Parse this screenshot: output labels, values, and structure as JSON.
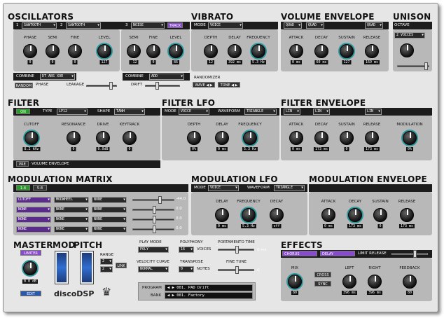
{
  "osc": {
    "title": "OSCILLATORS",
    "n1": "1",
    "w1": "SAWTOOTH",
    "n2": "2",
    "w2": "SAWTOOTH",
    "n3": "3",
    "w3": "NOISE",
    "track": "TRACK",
    "k": [
      {
        "l": "PHASE",
        "v": "0"
      },
      {
        "l": "SEMI",
        "v": "0"
      },
      {
        "l": "FINE",
        "v": "0"
      },
      {
        "l": "LEVEL",
        "v": "127"
      },
      {
        "l": "SEMI",
        "v": "-12"
      },
      {
        "l": "FINE",
        "v": "0"
      },
      {
        "l": "LEVEL",
        "v": "86"
      }
    ],
    "combine": "COMBINE",
    "comb1": "DT ABS XOR",
    "comb2": "ADD",
    "random": "RANDOM",
    "phase": "PHASE",
    "leakage": "LEAKAGE",
    "drift": "DRIFT"
  },
  "vib": {
    "title": "VIBRATO",
    "mode": "MODE",
    "modev": "VOICE",
    "k": [
      {
        "l": "DEPTH",
        "v": "12"
      },
      {
        "l": "DELAY",
        "v": "392 ms"
      },
      {
        "l": "FREQUENCY",
        "v": "5.3 Hz"
      }
    ],
    "randomizer": "RANDOMIZER",
    "wave": "WAVE",
    "tone": "TONE"
  },
  "venv": {
    "title": "VOLUME ENVELOPE",
    "q1": "QUAD",
    "q2": "QUAD",
    "q3": "QUAD",
    "k": [
      {
        "l": "ATTACK",
        "v": "0 ms"
      },
      {
        "l": "DECAY",
        "v": "60 ms"
      },
      {
        "l": "SUSTAIN",
        "v": "127"
      },
      {
        "l": "RELEASE",
        "v": "169 ms"
      }
    ]
  },
  "uni": {
    "title": "UNISON",
    "octave": "OCTAVE",
    "voices": "2 VOICES"
  },
  "flt": {
    "title": "FILTER",
    "on": "ON",
    "type": "TYPE",
    "typev": "LP12",
    "shape": "SHAPE",
    "shapev": "TANH",
    "k": [
      {
        "l": "CUTOFF",
        "v": "8.2 kHz"
      },
      {
        "l": "RESONANCE",
        "v": "0"
      },
      {
        "l": "DRIVE",
        "v": "0.0dB"
      },
      {
        "l": "KEYTRACK",
        "v": "0"
      }
    ],
    "pre": "PRE",
    "venv": "VOLUME ENVELOPE"
  },
  "flfo": {
    "title": "FILTER LFO",
    "mode": "MODE",
    "modev": "VOICE",
    "wf": "WAVEFORM",
    "wfv": "TRIANGLE",
    "k": [
      {
        "l": "DEPTH",
        "v": "0%"
      },
      {
        "l": "DELAY",
        "v": "0 ms"
      },
      {
        "l": "FREQUENCY",
        "v": "5.3 Hz"
      }
    ]
  },
  "fenv": {
    "title": "FILTER ENVELOPE",
    "l1": "LIN",
    "l2": "LIN",
    "l3": "LIN",
    "k": [
      {
        "l": "ATTACK",
        "v": "0 ms"
      },
      {
        "l": "DECAY",
        "v": "173 ms"
      },
      {
        "l": "SUSTAIN",
        "v": "0"
      },
      {
        "l": "RELEASE",
        "v": "173 ms"
      },
      {
        "l": "MODULATION",
        "v": "0%"
      }
    ]
  },
  "mm": {
    "title": "MODULATION MATRIX",
    "t1": "1-4",
    "t2": "5-8",
    "rows": [
      {
        "s": "CUTOFF",
        "a": "MODWHEEL",
        "b": "NONE",
        "v": "-44.0"
      },
      {
        "s": "NONE",
        "a": "NONE",
        "b": "NONE",
        "v": "0.0"
      },
      {
        "s": "NONE",
        "a": "NONE",
        "b": "NONE",
        "v": "0.0"
      },
      {
        "s": "NONE",
        "a": "NONE",
        "b": "NONE",
        "v": "0.0"
      }
    ]
  },
  "mlfo": {
    "title": "MODULATION LFO",
    "mode": "MODE",
    "modev": "VOICE",
    "wf": "WAVEFORM",
    "wfv": "TRIANGLE",
    "k": [
      {
        "l": "DELAY",
        "v": "0 ms"
      },
      {
        "l": "FREQUENCY",
        "v": "5.3 Hz"
      },
      {
        "l": "DECAY",
        "v": "off"
      }
    ]
  },
  "menv": {
    "title": "MODULATION ENVELOPE",
    "k": [
      {
        "l": "ATTACK",
        "v": "0 ms"
      },
      {
        "l": "DECAY",
        "v": "173 ms"
      },
      {
        "l": "SUSTAIN",
        "v": "0"
      },
      {
        "l": "RELEASE",
        "v": "173 ms"
      }
    ]
  },
  "mst": {
    "master": "MASTER",
    "mod": "MOD",
    "pitch": "PITCH",
    "limiter": "LIMITER",
    "vol": "0.0 dB",
    "edit": "EDIT",
    "range": "RANGE",
    "r1": "2",
    "r2": "2",
    "link": "LINK",
    "logo": "discoDSP",
    "play": "PLAY MODE",
    "playv": "POLY",
    "poly": "POLYPHONY",
    "polyv": "16",
    "voices": "VOICES",
    "porta": "PORTAMENTO TIME",
    "portav": "0 ms",
    "vc": "VELOCITY CURVE",
    "vcv": "NORMAL",
    "tr": "TRANSPOSE",
    "trv": "0",
    "notes": "NOTES",
    "ft": "FINE TUNE",
    "ftv": "0",
    "program": "PROGRAM",
    "progv": "001. PAD Drift",
    "bank": "BANK",
    "bankv": "001. Factory"
  },
  "fx": {
    "title": "EFFECTS",
    "chorus": "CHORUS",
    "delay": "DELAY",
    "limrel": "LIMIT RELEASE",
    "cross": "CROSS",
    "sync": "SYNC",
    "k": [
      {
        "l": "MIX",
        "v": "80"
      },
      {
        "l": "LEFT",
        "v": "396 ms"
      },
      {
        "l": "RIGHT",
        "v": "396 ms"
      },
      {
        "l": "FEEDBACK",
        "v": "80"
      }
    ]
  }
}
